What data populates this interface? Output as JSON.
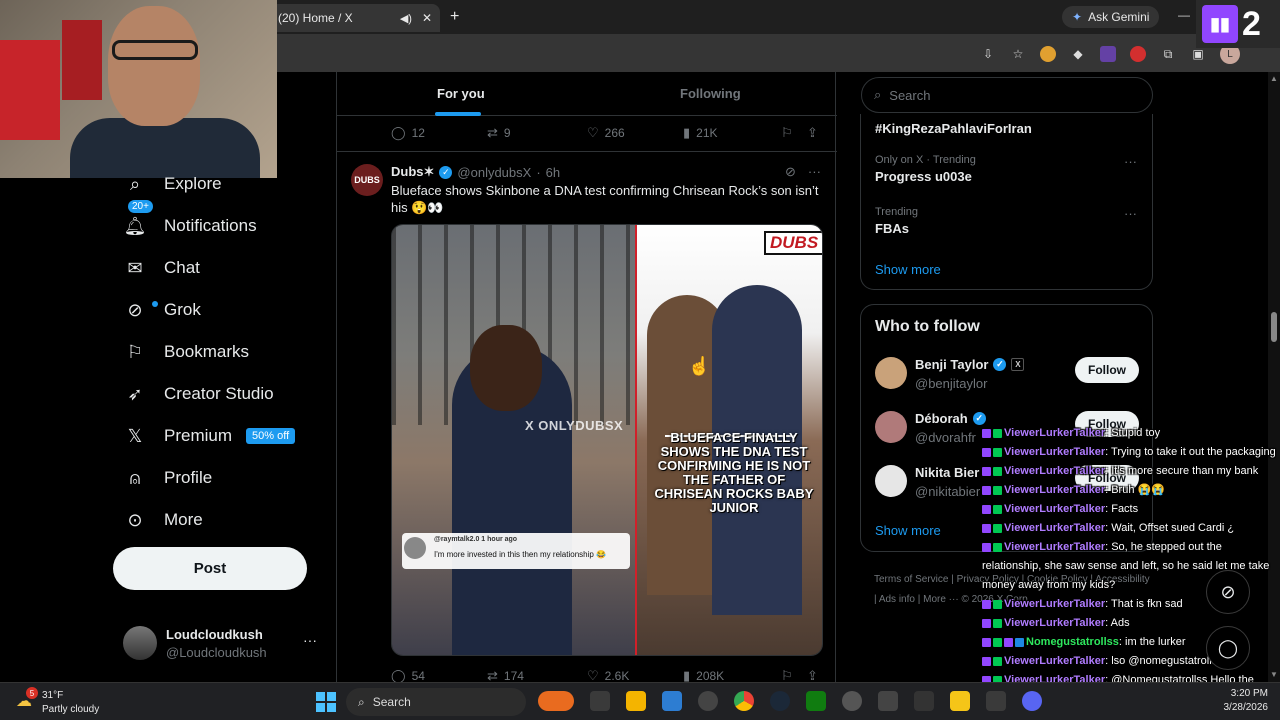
{
  "browser": {
    "tab_title": "(20) Home / X",
    "new_tab": "+",
    "gemini_label": "Ask Gemini",
    "profile_initial": "L",
    "stream_overlay_number": "2"
  },
  "nav": {
    "items": [
      {
        "label": "Explore",
        "icon": "search-icon"
      },
      {
        "label": "Notifications",
        "icon": "bell-icon",
        "badge": "20+"
      },
      {
        "label": "Chat",
        "icon": "mail-icon"
      },
      {
        "label": "Grok",
        "icon": "grok-icon"
      },
      {
        "label": "Bookmarks",
        "icon": "bookmark-icon"
      },
      {
        "label": "Creator Studio",
        "icon": "rocket-icon"
      },
      {
        "label": "Premium",
        "icon": "x-logo-icon",
        "badge": "50% off"
      },
      {
        "label": "Profile",
        "icon": "person-icon"
      },
      {
        "label": "More",
        "icon": "more-circle-icon"
      }
    ],
    "post_label": "Post",
    "account": {
      "name": "Loudcloudkush",
      "handle": "@Loudcloudkush"
    }
  },
  "feed": {
    "tabs": [
      "For you",
      "Following"
    ],
    "prev_actions": {
      "replies": "12",
      "reposts": "9",
      "likes": "266",
      "views": "21K"
    },
    "tweet": {
      "avatar_text": "DUBS",
      "name": "Dubs✶",
      "handle": "@onlydubsX",
      "time": "6h",
      "text": "Blueface shows Skinbone a DNA test confirming Chrisean Rock’s son isn’t his 😲👀",
      "media": {
        "logo": "DUBS",
        "watermark": "X ONLYDUBSX",
        "comment_user": "@raymtalk2.0  1 hour ago",
        "comment_text": "I'm more invested in this then my relationship 😂",
        "headline": "BLUEFACE FINALLY SHOWS THE DNA TEST CONFIRMING HE IS NOT THE FATHER OF CHRISEAN ROCKS BABY JUNIOR"
      },
      "actions": {
        "replies": "54",
        "reposts": "174",
        "likes": "2.6K",
        "views": "208K"
      }
    }
  },
  "sidebar": {
    "search_placeholder": "Search",
    "trends": [
      {
        "meta": "",
        "name": "#KingRezaPahlaviForIran"
      },
      {
        "meta": "Only on X · Trending",
        "name": "Progress u003e"
      },
      {
        "meta": "Trending",
        "name": "FBAs"
      }
    ],
    "show_more": "Show more",
    "who_to_follow_title": "Who to follow",
    "who_to_follow": [
      {
        "name": "Benji Taylor",
        "handle": "@benjitaylor",
        "button": "Follow"
      },
      {
        "name": "Déborah",
        "handle": "@dvorahfr",
        "button": "Follow"
      },
      {
        "name": "Nikita Bier",
        "handle": "@nikitabier",
        "button": "Follow"
      }
    ],
    "show_more_2": "Show more",
    "footer": "Terms of Service  |  Privacy Policy  |  Cookie Policy  |  Accessibility  |  Ads info  |  More ··· © 2026 X Corp."
  },
  "chat": [
    {
      "user": "ViewerLurkerTalker",
      "msg": ": Stupid toy",
      "badges": [
        "purple",
        "green"
      ]
    },
    {
      "user": "ViewerLurkerTalker",
      "msg": ": Trying to take it out the packaging",
      "badges": [
        "purple",
        "green"
      ]
    },
    {
      "user": "ViewerLurkerTalker",
      "msg": ": It's more secure than my bank",
      "badges": [
        "purple",
        "green"
      ]
    },
    {
      "user": "ViewerLurkerTalker",
      "msg": ": Bruh 😭😭",
      "badges": [
        "purple",
        "green"
      ]
    },
    {
      "user": "ViewerLurkerTalker",
      "msg": ": Facts",
      "badges": [
        "purple",
        "green"
      ]
    },
    {
      "user": "ViewerLurkerTalker",
      "msg": ": Wait, Offset sued Cardi ¿",
      "badges": [
        "purple",
        "green"
      ]
    },
    {
      "user": "ViewerLurkerTalker",
      "msg": ": So, he stepped out the relationship, she saw sense and left, so he said let me take money away from my kids?",
      "badges": [
        "purple",
        "green"
      ]
    },
    {
      "user": "ViewerLurkerTalker",
      "msg": ": That is fkn sad",
      "badges": [
        "purple",
        "green"
      ]
    },
    {
      "user": "ViewerLurkerTalker",
      "msg": ": Ads",
      "badges": [
        "purple",
        "green"
      ]
    },
    {
      "user": "Nomegustatrollss",
      "msg": ": im the lurker",
      "badges": [
        "purple",
        "green",
        "purple",
        "blue"
      ]
    },
    {
      "user": "ViewerLurkerTalker",
      "msg": ": lso @nomegustatrollss",
      "badges": [
        "purple",
        "green"
      ]
    },
    {
      "user": "ViewerLurkerTalker",
      "msg": ": @Nomegustatrollss Hello the Lurker",
      "badges": [
        "purple",
        "green"
      ]
    }
  ],
  "taskbar": {
    "weather_badge": "5",
    "temp": "31°F",
    "weather_desc": "Partly cloudy",
    "search_label": "Search",
    "time": "3:20 PM",
    "date": "3/28/2026"
  },
  "colors": {
    "accent": "#1d9bf0",
    "chat_user": "#b07cff",
    "chat_user_alt": "#2ee85e"
  }
}
